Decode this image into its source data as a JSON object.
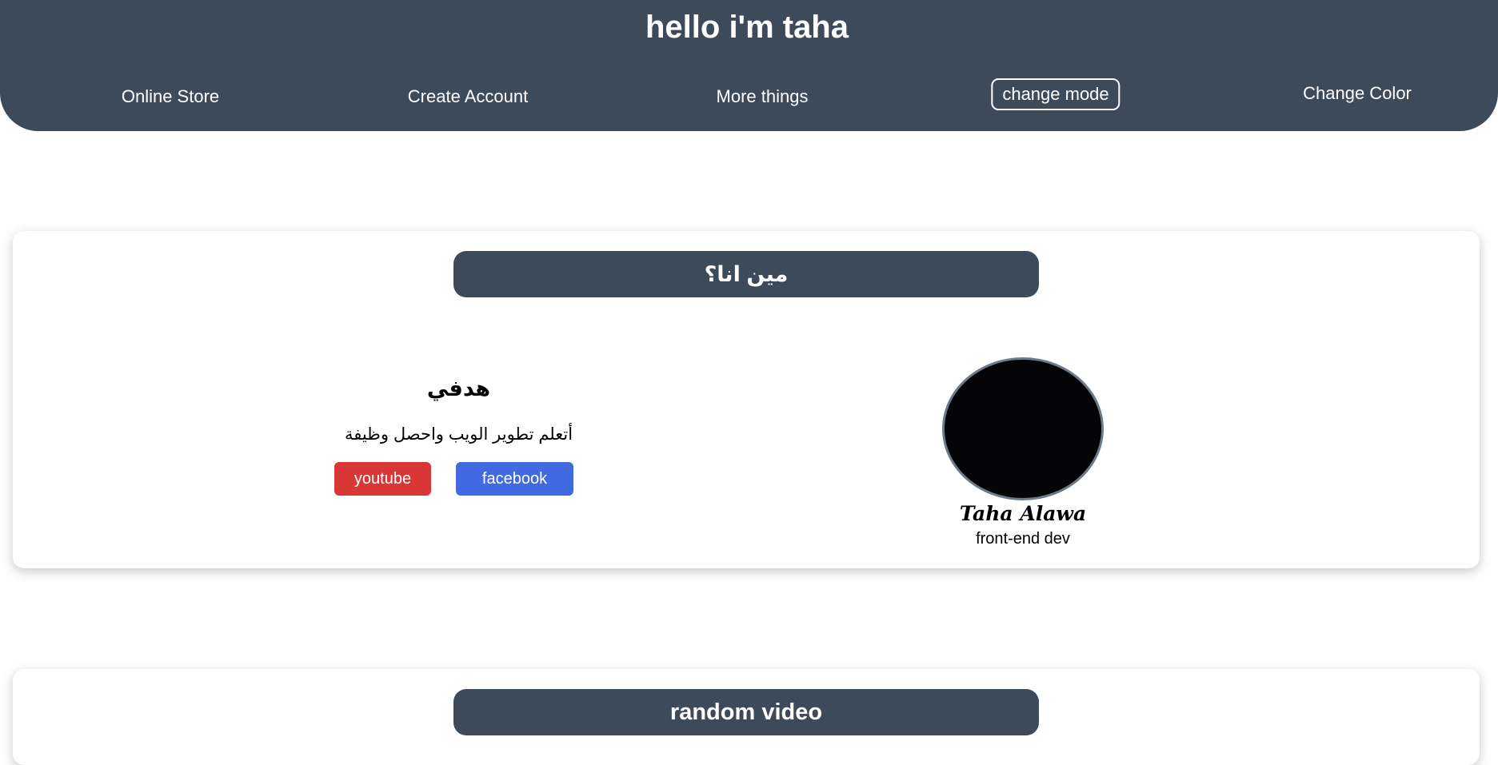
{
  "header": {
    "title": "hello i'm taha",
    "nav": {
      "online_store": "Online Store",
      "create_account": "Create Account",
      "more_things": "More things",
      "change_mode": "change mode",
      "change_color": "Change Color"
    }
  },
  "about": {
    "section_title": "مين انا؟",
    "goal_title": "هدفي",
    "goal_text": "أتعلم تطوير الويب واحصل وظيفة",
    "youtube_label": "youtube",
    "facebook_label": "facebook",
    "profile_name": "Taha Alawa",
    "profile_role": "front-end dev"
  },
  "video": {
    "section_title": "random video"
  },
  "colors": {
    "header_bg": "#3d4a5a",
    "youtube": "#d93636",
    "facebook": "#4169e1",
    "avatar": "#050407"
  }
}
